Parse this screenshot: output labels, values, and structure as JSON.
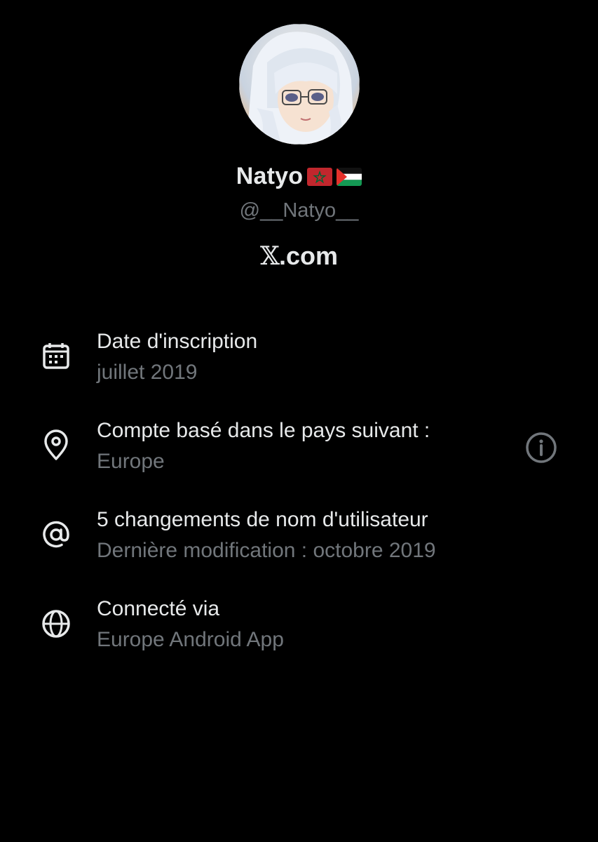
{
  "profile": {
    "name": "Natyo",
    "flags": [
      "morocco-flag",
      "palestine-flag"
    ],
    "handle": "@__Natyo__",
    "site": ".com",
    "site_logo": "x-logo"
  },
  "about": {
    "rows": [
      {
        "icon": "calendar-icon",
        "title": "Date d'inscription",
        "subtitle": "juillet 2019"
      },
      {
        "icon": "location-pin-icon",
        "title": "Compte basé dans le pays suivant :",
        "subtitle": "Europe",
        "action_icon": "info-icon"
      },
      {
        "icon": "at-sign-icon",
        "title": "5 changements de nom d'utilisateur",
        "subtitle": "Dernière modification : octobre 2019"
      },
      {
        "icon": "globe-icon",
        "title": "Connecté via",
        "subtitle": "Europe Android App"
      }
    ]
  },
  "colors": {
    "background": "#000000",
    "primary_text": "#e7e9ea",
    "secondary_text": "#71767b"
  }
}
